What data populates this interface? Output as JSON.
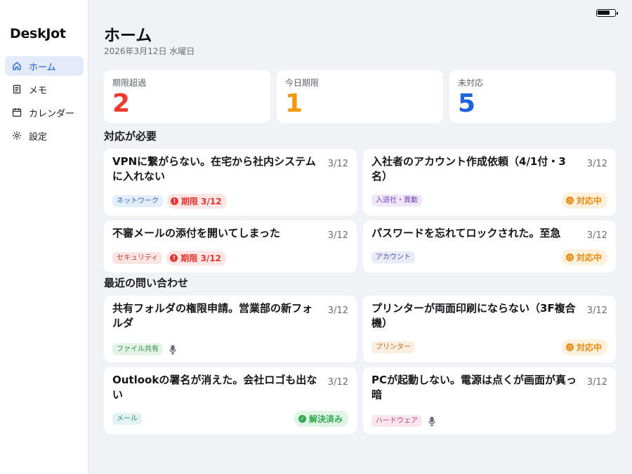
{
  "app": {
    "name": "DeskJot"
  },
  "sidebar": {
    "items": [
      {
        "label": "ホーム",
        "icon": "home-icon",
        "active": true
      },
      {
        "label": "メモ",
        "icon": "memo-icon",
        "active": false
      },
      {
        "label": "カレンダー",
        "icon": "calendar-icon",
        "active": false
      },
      {
        "label": "設定",
        "icon": "gear-icon",
        "active": false
      }
    ]
  },
  "header": {
    "title": "ホーム",
    "date": "2026年3月12日 水曜日"
  },
  "stats": [
    {
      "label": "期限超過",
      "value": "2",
      "color": "#f0392d"
    },
    {
      "label": "今日期限",
      "value": "1",
      "color": "#f29a0d"
    },
    {
      "label": "未対応",
      "value": "5",
      "color": "#1f63df"
    }
  ],
  "sections": {
    "action_required": "対応が必要",
    "recent": "最近の問い合わせ"
  },
  "action_cards": [
    {
      "title": "VPNに繋がらない。在宅から社内システムに入れない",
      "date": "3/12",
      "tag": "ネットワーク",
      "tag_bg": "#e4edfb",
      "tag_fg": "#3266b8",
      "due": "期限 3/12"
    },
    {
      "title": "入社者のアカウント作成依頼（4/1付・3名）",
      "date": "3/12",
      "tag": "入退社・異動",
      "tag_bg": "#efe6f8",
      "tag_fg": "#7a46b8",
      "status": "対応中",
      "status_kind": "inprog"
    },
    {
      "title": "不審メールの添付を開いてしまった",
      "date": "3/12",
      "tag": "セキュリティ",
      "tag_bg": "#fbe5e3",
      "tag_fg": "#c0413a",
      "due": "期限 3/12"
    },
    {
      "title": "パスワードを忘れてロックされた。至急",
      "date": "3/12",
      "tag": "アカウント",
      "tag_bg": "#e9ebf8",
      "tag_fg": "#4c54a8",
      "status": "対応中",
      "status_kind": "inprog"
    }
  ],
  "recent_cards": [
    {
      "title": "共有フォルダの権限申請。営業部の新フォルダ",
      "date": "3/12",
      "tag": "ファイル共有",
      "tag_bg": "#e3f4e6",
      "tag_fg": "#2f8a45",
      "voice": true
    },
    {
      "title": "プリンターが両面印刷にならない（3F複合機）",
      "date": "3/12",
      "tag": "プリンター",
      "tag_bg": "#fbeee0",
      "tag_fg": "#c26b1d",
      "status": "対応中",
      "status_kind": "inprog"
    },
    {
      "title": "Outlookの署名が消えた。会社ロゴも出ない",
      "date": "3/12",
      "tag": "メール",
      "tag_bg": "#e2f3f1",
      "tag_fg": "#2b8a7e",
      "status": "解決済み",
      "status_kind": "done"
    },
    {
      "title": "PCが起動しない。電源は点くが画面が真っ暗",
      "date": "3/12",
      "tag": "ハードウェア",
      "tag_bg": "#fbe6ee",
      "tag_fg": "#b83f6e",
      "voice": true
    }
  ]
}
